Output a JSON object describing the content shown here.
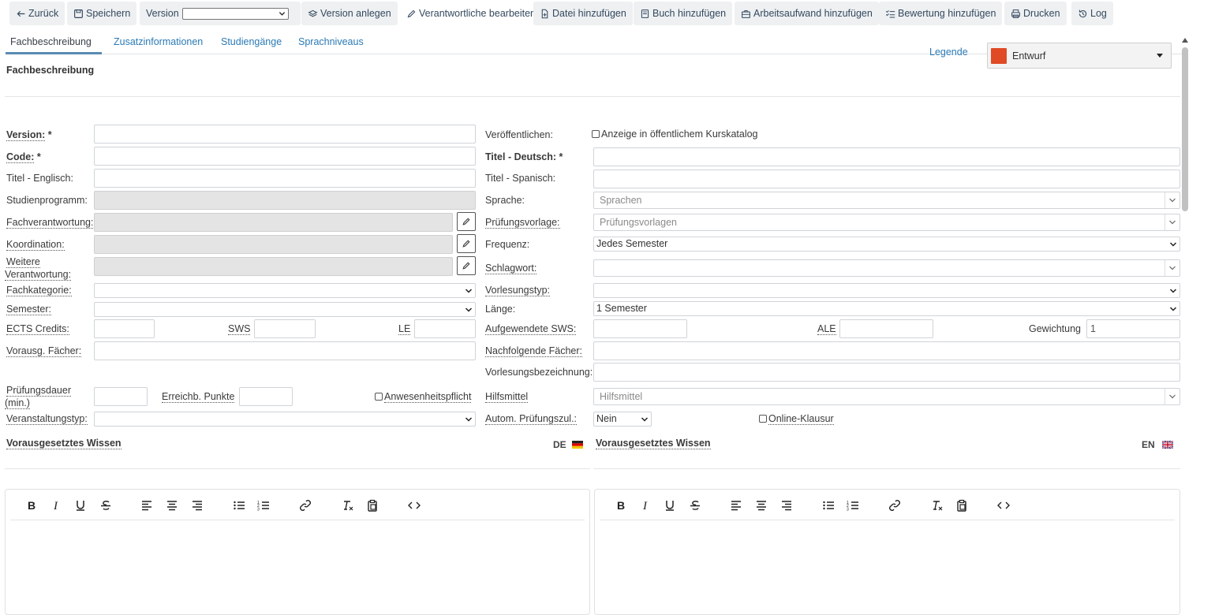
{
  "toolbar": {
    "back": "Zurück",
    "save": "Speichern",
    "version_label": "Version",
    "create_version": "Version anlegen",
    "edit_responsible": "Verantwortliche bearbeiten",
    "add_file": "Datei hinzufügen",
    "add_book": "Buch hinzufügen",
    "add_workload": "Arbeitsaufwand hinzufügen",
    "add_rating": "Bewertung hinzufügen",
    "print": "Drucken",
    "log": "Log"
  },
  "tabs": [
    "Fachbeschreibung",
    "Zusatzinformationen",
    "Studiengänge",
    "Sprachniveaus"
  ],
  "legend_link": "Legende",
  "status": {
    "value": "Entwurf",
    "color": "#e04a25"
  },
  "section_title": "Fachbeschreibung",
  "left": {
    "version": "Version:",
    "version_req": " *",
    "code": "Code:",
    "code_req": " *",
    "title_en": "Titel - Englisch:",
    "program": "Studienprogramm:",
    "responsible": "Fachverantwortung:",
    "coordination": "Koordination:",
    "further_1": "Weitere",
    "further_2": "Verantwortung:",
    "category": "Fachkategorie:",
    "semester": "Semester:",
    "ects": "ECTS Credits:",
    "sws": "SWS",
    "le": "LE",
    "prereq_subjects": "Vorausg. Fächer:",
    "exam_duration_1": "Prüfungsdauer",
    "exam_duration_2": "(min.)",
    "points": "Erreichb. Punkte",
    "attendance": "Anwesenheitspflicht",
    "event_type": "Veranstaltungstyp:"
  },
  "right": {
    "publish": "Veröffentlichen:",
    "publish_cb": "Anzeige in öffentlichem Kurskatalog",
    "title_de": "Titel - Deutsch:",
    "title_de_req": " *",
    "title_es": "Titel - Spanisch:",
    "language": "Sprache:",
    "language_ph": "Sprachen",
    "exam_template": "Prüfungsvorlage:",
    "exam_template_ph": "Prüfungsvorlagen",
    "frequency": "Frequenz:",
    "frequency_value": "Jedes Semester",
    "keyword": "Schlagwort:",
    "lecture_type": "Vorlesungstyp:",
    "length": "Länge:",
    "length_value": "1 Semester",
    "used_sws": "Aufgewendete SWS:",
    "ale": "ALE",
    "weighting": "Gewichtung",
    "weighting_value": "1",
    "following_subjects": "Nachfolgende Fächer:",
    "lecture_name": "Vorlesungsbezeichnung:",
    "aids": "Hilfsmittel",
    "aids_ph": "Hilfsmittel",
    "auto_admission": "Autom. Prüfungszul.:",
    "auto_admission_value": "Nein",
    "online_exam": "Online-Klausur"
  },
  "prior_knowledge": {
    "de_title": "Vorausgesetztes Wissen",
    "de_tag": "DE",
    "en_title": "Vorausgesetztes Wissen",
    "en_tag": "EN"
  }
}
